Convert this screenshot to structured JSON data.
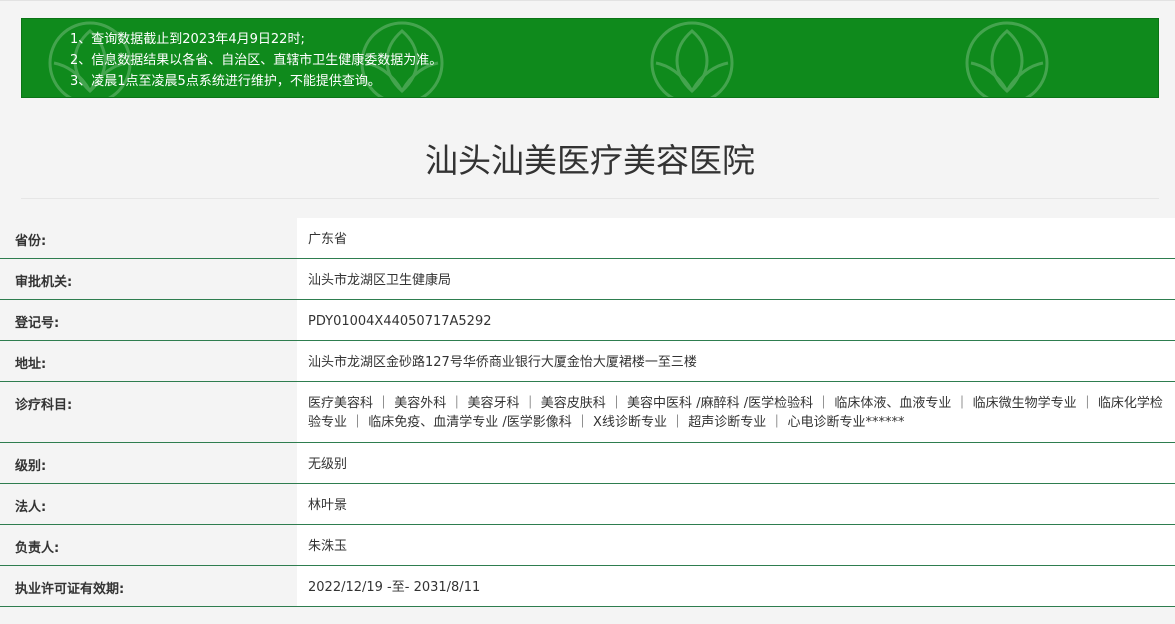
{
  "notice": {
    "lines": [
      "1、查询数据截止到2023年4月9日22时;",
      "2、信息数据结果以各省、自治区、直辖市卫生健康委数据为准。",
      "3、凌晨1点至凌晨5点系统进行维护，不能提供查询。"
    ]
  },
  "title": "汕头汕美医疗美容医院",
  "rows": [
    {
      "label": "省份:",
      "value": "广东省"
    },
    {
      "label": "审批机关:",
      "value": "汕头市龙湖区卫生健康局"
    },
    {
      "label": "登记号:",
      "value": "PDY01004X44050717A5292"
    },
    {
      "label": "地址:",
      "value": "汕头市龙湖区金砂路127号华侨商业银行大厦金怡大厦裙楼一至三楼"
    },
    {
      "label": "诊疗科目:",
      "value": "医疗美容科 ｜ 美容外科 ｜ 美容牙科 ｜ 美容皮肤科 ｜ 美容中医科 /麻醉科 /医学检验科 ｜ 临床体液、血液专业 ｜ 临床微生物学专业 ｜ 临床化学检验专业 ｜ 临床免疫、血清学专业 /医学影像科 ｜ X线诊断专业 ｜ 超声诊断专业 ｜ 心电诊断专业******"
    },
    {
      "label": "级别:",
      "value": "无级别"
    },
    {
      "label": "法人:",
      "value": "林叶景"
    },
    {
      "label": "负责人:",
      "value": "朱洙玉"
    },
    {
      "label": "执业许可证有效期:",
      "value": "2022/12/19 -至- 2031/8/11"
    }
  ],
  "colors": {
    "notice_bg": "#0f8a1c",
    "row_border": "#2e7d4f"
  }
}
